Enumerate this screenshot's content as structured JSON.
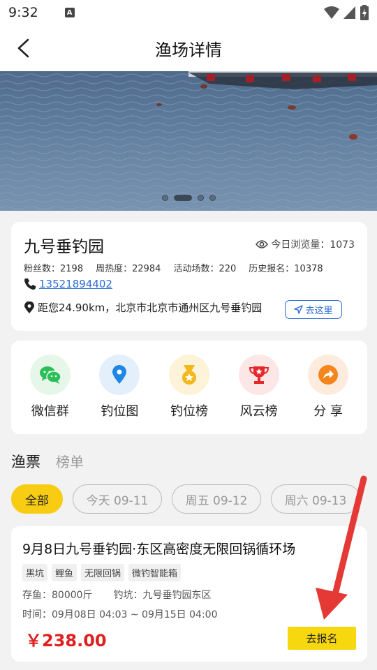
{
  "status_bar": {
    "time": "9:32",
    "notification_icon": "A"
  },
  "nav": {
    "title": "渔场详情"
  },
  "banner": {
    "slide_count": 4,
    "active_slide": 1
  },
  "venue": {
    "name": "九号垂钓园",
    "views_label": "今日浏览量：1073",
    "stats": [
      "粉丝数：2198",
      "周热度：22984",
      "活动场数：220",
      "历史报名：10378"
    ],
    "phone": "13521894402",
    "address": "距您24.90km，北京市北京市通州区九号垂钓园",
    "go_label": "去这里"
  },
  "menu": [
    {
      "label": "微信群",
      "icon": "wechat-icon",
      "bg": "#e6f7ea",
      "color": "#2bbf58"
    },
    {
      "label": "钓位图",
      "icon": "map-pin-icon",
      "bg": "#e3f0fb",
      "color": "#1e86e5"
    },
    {
      "label": "钓位榜",
      "icon": "medal-icon",
      "bg": "#fcf3d8",
      "color": "#f3b81c"
    },
    {
      "label": "风云榜",
      "icon": "trophy-icon",
      "bg": "#fde6e6",
      "color": "#e5262b"
    },
    {
      "label": "分 享",
      "icon": "share-icon",
      "bg": "#fdecde",
      "color": "#f5861c"
    }
  ],
  "tabs": [
    "渔票",
    "榜单"
  ],
  "filters": [
    "全部",
    "今天 09-11",
    "周五 09-12",
    "周六 09-13"
  ],
  "ticket": {
    "title": "9月8日九号垂钓园·东区高密度无限回锅循环场",
    "tags": [
      "黑坑",
      "鲤鱼",
      "无限回锅",
      "微钓智能箱"
    ],
    "stock": "存鱼：80000斤",
    "pit": "钓坑：九号垂钓园东区",
    "time": "时间：09月08日 04:03 ~ 09月15日 04:00",
    "price": "￥238.00",
    "signup_label": "去报名"
  },
  "colors": {
    "accent_yellow": "#f7cc12",
    "price_red": "#e02020",
    "link_blue": "#2a6dd6",
    "annotation_arrow": "#e53935"
  }
}
